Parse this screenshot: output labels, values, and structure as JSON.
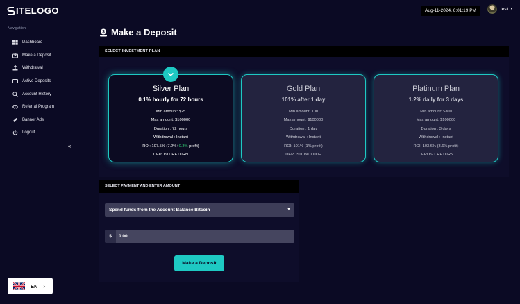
{
  "brand": {
    "logo_text": "ITELOGO"
  },
  "header": {
    "datetime": "Aug-11-2024, 6:01:19 PM",
    "username": "test"
  },
  "sidebar": {
    "heading": "Navigation",
    "items": [
      {
        "label": "Dashboard",
        "icon": "grid-icon"
      },
      {
        "label": "Make a Deposit",
        "icon": "deposit-icon"
      },
      {
        "label": "Withdrawal",
        "icon": "withdraw-icon"
      },
      {
        "label": "Active Deposits",
        "icon": "active-deposits-icon"
      },
      {
        "label": "Account History",
        "icon": "history-icon"
      },
      {
        "label": "Referral Program",
        "icon": "referral-icon"
      },
      {
        "label": "Banner Ads",
        "icon": "banner-icon"
      },
      {
        "label": "Logout",
        "icon": "power-icon"
      }
    ]
  },
  "language": {
    "code": "EN"
  },
  "page": {
    "title": "Make a Deposit"
  },
  "plans_section": {
    "header": "SELECT INVESTMENT PLAN",
    "plans": [
      {
        "name": "Silver Plan",
        "rate": "0.1% hourly for 72 hours",
        "min": "Min amount: $25",
        "max": "Max amount: $100000",
        "duration": "Duration : 72 hours",
        "withdrawal": "Withdrawal : Instant",
        "roi_prefix": "ROI: 107.5% (7.2%+",
        "roi_highlight": "0.3%",
        "roi_suffix": " profit)",
        "return": "DEPOSIT RETURN",
        "selected": true
      },
      {
        "name": "Gold Plan",
        "rate": "101% after 1 day",
        "min": "Min amount: 100",
        "max": "Max amount: $100000",
        "duration": "Duration : 1 day",
        "withdrawal": "Withdrawal : Instant",
        "roi": "ROI: 101% (1% profit)",
        "return": "DEPOSIT INCLUDE",
        "selected": false
      },
      {
        "name": "Platinum Plan",
        "rate": "1.2% daily for 3 days",
        "min": "Min amount: $300",
        "max": "Max amount: $100000",
        "duration": "Duration : 3 days",
        "withdrawal": "Withdrawal : Instant",
        "roi": "ROI: 103.6% (3.6% profit)",
        "return": "DEPOSIT RETURN",
        "selected": false
      }
    ]
  },
  "payment_section": {
    "header": "SELECT PAYMENT AND ENTER AMOUNT",
    "source_selected": "Spend funds from the Account Balance Bitcoin",
    "currency_prefix": "$",
    "amount_value": "0.00",
    "submit_label": "Make a Deposit"
  },
  "colors": {
    "accent": "#1ec9c3",
    "background": "#0b0a24",
    "highlight_green": "#2ecc71"
  }
}
